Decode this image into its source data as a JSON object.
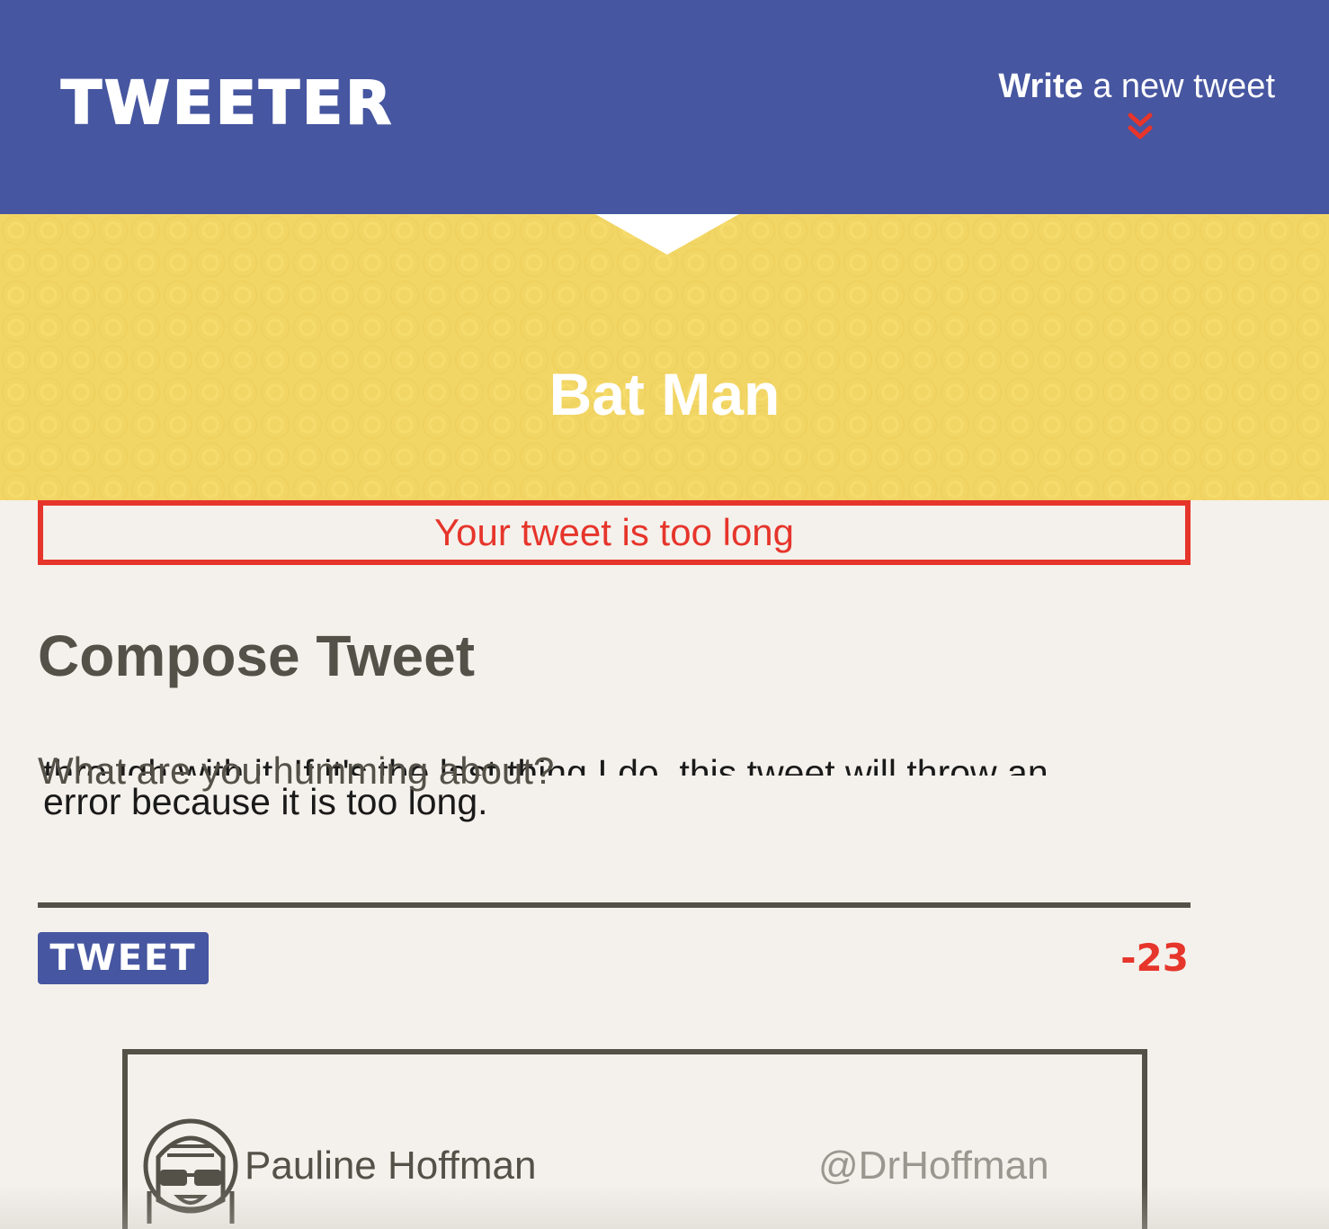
{
  "nav": {
    "logo": "TWEETER",
    "compose_link_bold": "Write",
    "compose_link_rest": " a new tweet",
    "chevron_icon": "double-chevron-down-icon",
    "chevron_color": "#e6352b",
    "background": "#4656a0"
  },
  "header": {
    "username": "Bat Man",
    "background": "#f2d665"
  },
  "error": {
    "message": "Your tweet is too long",
    "color": "#e6352b"
  },
  "compose": {
    "title": "Compose Tweet",
    "textarea_label": "What are you humming about?",
    "text_line_1": "through with it. If it's the last thing I do, this tweet will throw an",
    "text_line_2": "error because it is too long.",
    "button_label": "TWEET",
    "counter": "-23"
  },
  "tweet": {
    "author_name": "Pauline Hoffman",
    "author_handle": "@DrHoffman",
    "avatar_icon": "avatar-icon"
  }
}
